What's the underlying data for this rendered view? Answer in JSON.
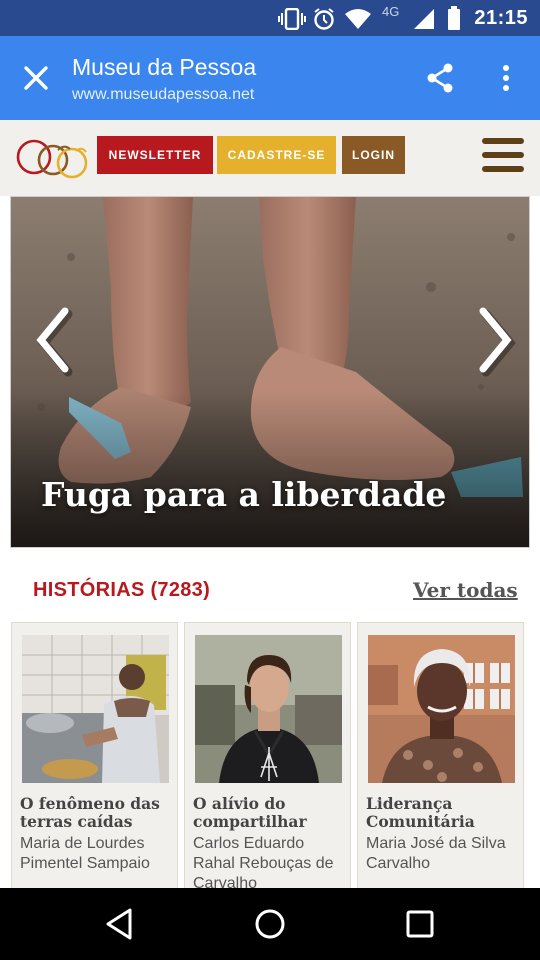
{
  "status_bar": {
    "time": "21:15",
    "network": "4G",
    "icons": [
      "vibrate-icon",
      "alarm-icon",
      "wifi-icon",
      "signal-icon",
      "battery-icon"
    ]
  },
  "toolbar": {
    "title": "Museu da Pessoa",
    "url": "www.museudapessoa.net",
    "color": "#3a85ee"
  },
  "header": {
    "buttons": {
      "newsletter": "NEWSLETTER",
      "cadastre": "CADASTRE-SE",
      "login": "LOGIN"
    },
    "colors": {
      "newsletter": "#b8191f",
      "cadastre": "#e5b02c",
      "login": "#8a5a26"
    }
  },
  "hero": {
    "caption": "Fuga para a liberdade"
  },
  "stories": {
    "heading": "HISTÓRIAS (7283)",
    "see_all": "Ver todas",
    "items": [
      {
        "title": "O fenômeno das terras caídas",
        "person": "Maria de Lourdes Pimentel Sampaio"
      },
      {
        "title": "O alívio do compartilhar",
        "person": "Carlos Eduardo Rahal Rebouças de Carvalho"
      },
      {
        "title": "Liderança Comunitária",
        "person": "Maria José da Silva Carvalho"
      }
    ]
  }
}
